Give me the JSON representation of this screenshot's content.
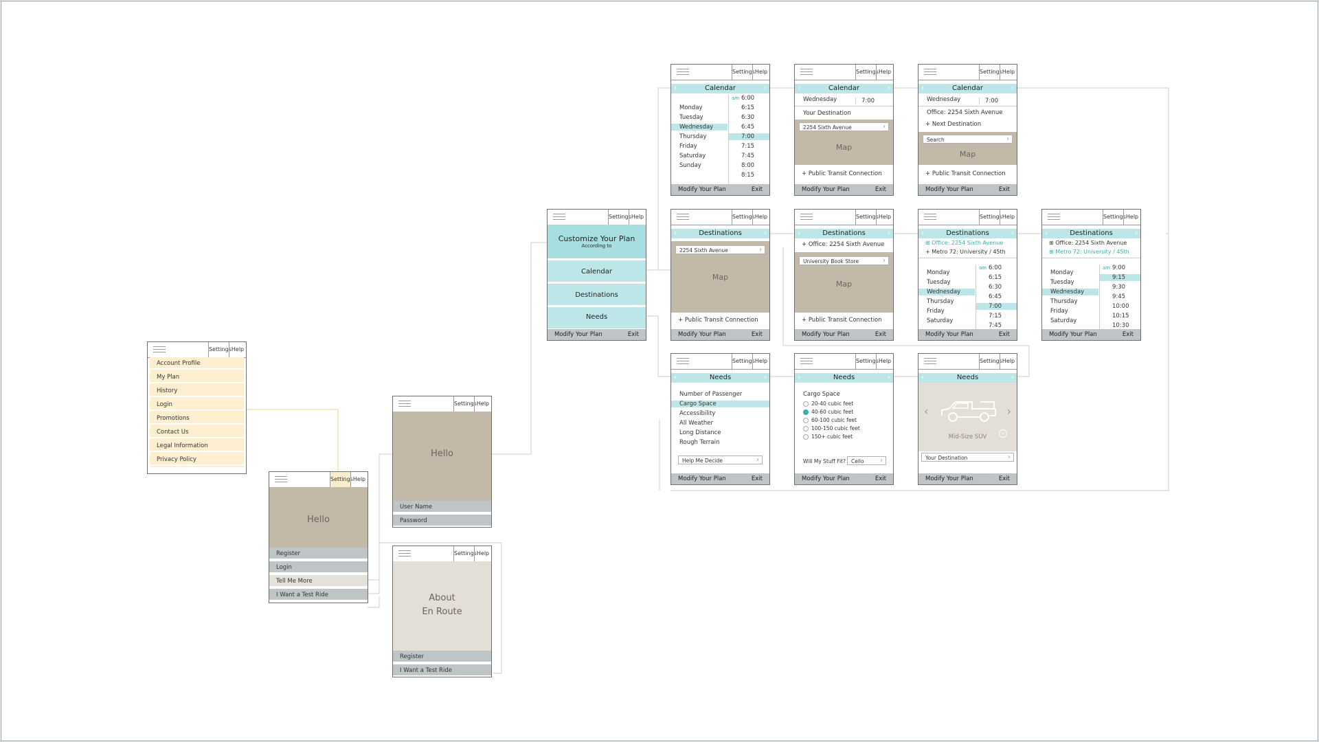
{
  "common": {
    "settings": "Settings",
    "help": "Help",
    "modify": "Modify Your Plan",
    "exit": "Exit"
  },
  "menu_screen": {
    "items": [
      "Account Profile",
      "My Plan",
      "History",
      "Login",
      "Promotions",
      "Contact Us",
      "Legal Information",
      "Privacy Policy"
    ]
  },
  "hello_screen": {
    "greeting": "Hello",
    "items": [
      "Register",
      "Login",
      "Tell Me More",
      "I Want a Test Ride"
    ]
  },
  "login_screen": {
    "greeting": "Hello",
    "user": "User Name",
    "password": "Password"
  },
  "about_screen": {
    "line1": "About",
    "line2": "En Route",
    "items": [
      "Register",
      "I Want a Test Ride"
    ]
  },
  "customize_screen": {
    "title": "Customize Your Plan",
    "subtitle": "According to",
    "options": [
      "Calendar",
      "Destinations",
      "Needs"
    ]
  },
  "calendar1": {
    "title": "Calendar",
    "days": [
      "Monday",
      "Tuesday",
      "Wednesday",
      "Thursday",
      "Friday",
      "Saturday",
      "Sunday"
    ],
    "am": "am",
    "times": [
      "6:00",
      "6:15",
      "6:30",
      "6:45",
      "7:00",
      "7:15",
      "7:45",
      "8:00",
      "8:15"
    ]
  },
  "calendar2": {
    "title": "Calendar",
    "day": "Wednesday",
    "time": "7:00",
    "dest_label": "Your Destination",
    "input": "2254 Sixth Avenue",
    "map": "Map",
    "transit": "Public Transit Connection"
  },
  "calendar3": {
    "title": "Calendar",
    "day": "Wednesday",
    "time": "7:00",
    "office": "Office: 2254 Sixth Avenue",
    "next": "Next Destination",
    "search": "Search",
    "map": "Map",
    "transit": "Public Transit Connection"
  },
  "dest1": {
    "title": "Destinations",
    "input": "2254 Sixth Avenue",
    "map": "Map",
    "transit": "Public Transit Connection"
  },
  "dest2": {
    "title": "Destinations",
    "office": "Office: 2254 Sixth Avenue",
    "input": "University Book Store",
    "map": "Map",
    "transit": "Public Transit Connection"
  },
  "dest3": {
    "title": "Destinations",
    "office": "Office: 2254 Sixth Avenue",
    "metro": "Metro 72: University / 45th",
    "days": [
      "Monday",
      "Tuesday",
      "Wednesday",
      "Thursday",
      "Friday",
      "Saturday"
    ],
    "am": "am",
    "times": [
      "6:00",
      "6:15",
      "6:30",
      "6:45",
      "7:00",
      "7:15",
      "7:45"
    ]
  },
  "dest4": {
    "title": "Destinations",
    "office": "Office: 2254 Sixth Avenue",
    "metro": "Metro 72: University / 45th",
    "days": [
      "Monday",
      "Tuesday",
      "Wednesday",
      "Thursday",
      "Friday",
      "Saturday"
    ],
    "am": "am",
    "times": [
      "9:00",
      "9:15",
      "9:30",
      "9:45",
      "10:00",
      "10:15",
      "10:30"
    ]
  },
  "needs1": {
    "title": "Needs",
    "items": [
      "Number of Passenger",
      "Cargo Space",
      "Accessibility",
      "All Weather",
      "Long Distance",
      "Rough Terrain"
    ],
    "decide": "Help Me Decide"
  },
  "needs2": {
    "title": "Needs",
    "heading": "Cargo Space",
    "options": [
      "20-40 cubic feet",
      "40-60 cubic feet",
      "60-100 cubic feet",
      "100-150 cubic feet",
      "150+ cubic feet"
    ],
    "fit_label": "Will My Stuff Fit?",
    "fit_value": "Cello"
  },
  "needs3": {
    "title": "Needs",
    "vehicle": "Mid-Size SUV",
    "input": "Your Destination"
  }
}
